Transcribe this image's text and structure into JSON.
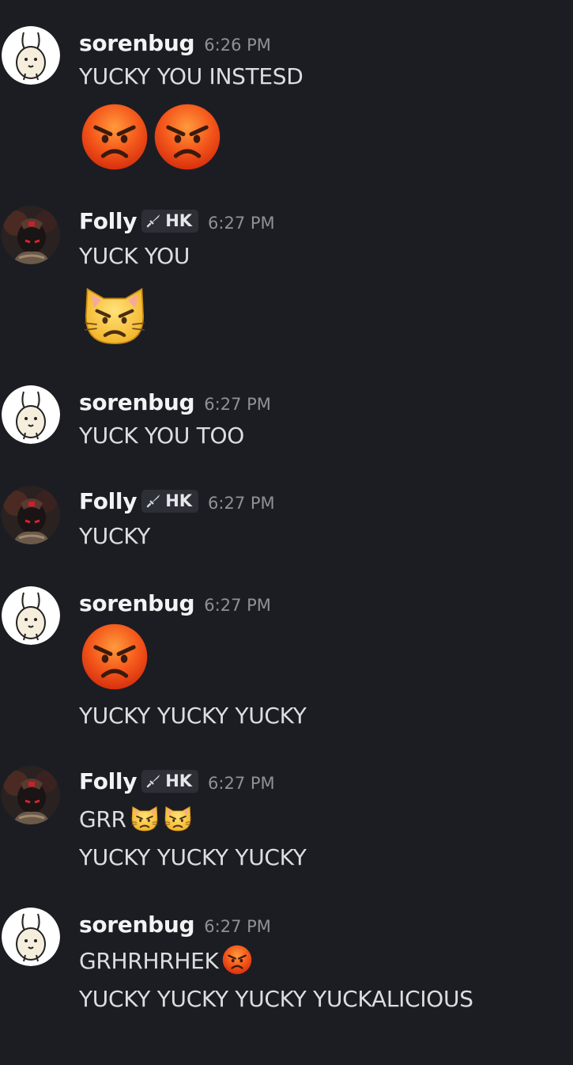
{
  "messages": [
    {
      "author": "sorenbug",
      "time": "6:26 PM",
      "lines": [
        "YUCKY YOU INSTESD"
      ],
      "emojis": [
        "angry-face-emoji",
        "angry-face-emoji"
      ]
    },
    {
      "author": "Folly",
      "tag": "HK",
      "time": "6:27 PM",
      "lines": [
        "YUCK YOU"
      ],
      "emojis": [
        "pouting-cat-emoji"
      ]
    },
    {
      "author": "sorenbug",
      "time": "6:27 PM",
      "lines": [
        "YUCK YOU TOO"
      ]
    },
    {
      "author": "Folly",
      "tag": "HK",
      "time": "6:27 PM",
      "lines": [
        "YUCKY"
      ]
    },
    {
      "author": "sorenbug",
      "time": "6:27 PM",
      "lines": [
        "YUCKY YUCKY YUCKY"
      ],
      "emojis": [
        "angry-face-emoji"
      ]
    },
    {
      "author": "Folly",
      "tag": "HK",
      "time": "6:27 PM",
      "lines": [
        "GRR",
        "YUCKY YUCKY YUCKY"
      ],
      "emojis": [
        "pouting-cat-emoji",
        "pouting-cat-emoji"
      ]
    },
    {
      "author": "sorenbug",
      "time": "6:27 PM",
      "lines": [
        "GRHRHRHEK",
        "YUCKY YUCKY YUCKY YUCKALICIOUS"
      ],
      "emojis": [
        "angry-face-emoji"
      ]
    }
  ],
  "colors": {
    "background": "#1c1d22",
    "name": "#f2f3f5",
    "timestamp": "#8e9199",
    "text": "#dcdde1",
    "tag_bg": "#2d2f37"
  }
}
